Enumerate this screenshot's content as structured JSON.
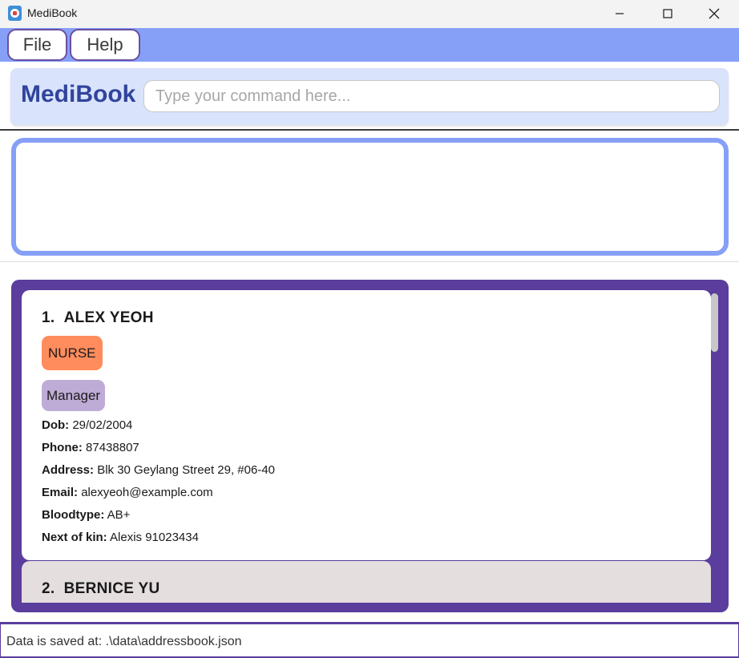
{
  "window": {
    "title": "MediBook",
    "icon": "medibook-app-icon",
    "controls": [
      "minimize-icon",
      "maximize-icon",
      "close-icon"
    ]
  },
  "menu": {
    "file_label": "File",
    "help_label": "Help"
  },
  "command": {
    "brand": "MediBook",
    "placeholder": "Type your command here...",
    "value": ""
  },
  "result": {
    "text": ""
  },
  "persons": [
    {
      "index": "1.",
      "name": "ALEX YEOH",
      "role": "NURSE",
      "tags": [
        "Manager"
      ],
      "dob_label": "Dob:",
      "dob": "29/02/2004",
      "phone_label": "Phone:",
      "phone": "87438807",
      "address_label": "Address:",
      "address": "Blk 30 Geylang Street 29, #06-40",
      "email_label": "Email:",
      "email": "alexyeoh@example.com",
      "bloodtype_label": "Bloodtype:",
      "bloodtype": "AB+",
      "kin_label": "Next of kin:",
      "kin": "Alexis 91023434"
    },
    {
      "index": "2.",
      "name": "BERNICE YU"
    }
  ],
  "status": {
    "text": "Data is saved at: .\\data\\addressbook.json"
  },
  "colors": {
    "menubar": "#86a0f7",
    "command_box": "#d9e3fb",
    "brand_text": "#30449c",
    "list_border": "#5a3d9c",
    "role_tag": "#ff8c5c",
    "tag": "#bfacd6",
    "selected_card": "#ffffff",
    "card": "#e4dedf"
  }
}
